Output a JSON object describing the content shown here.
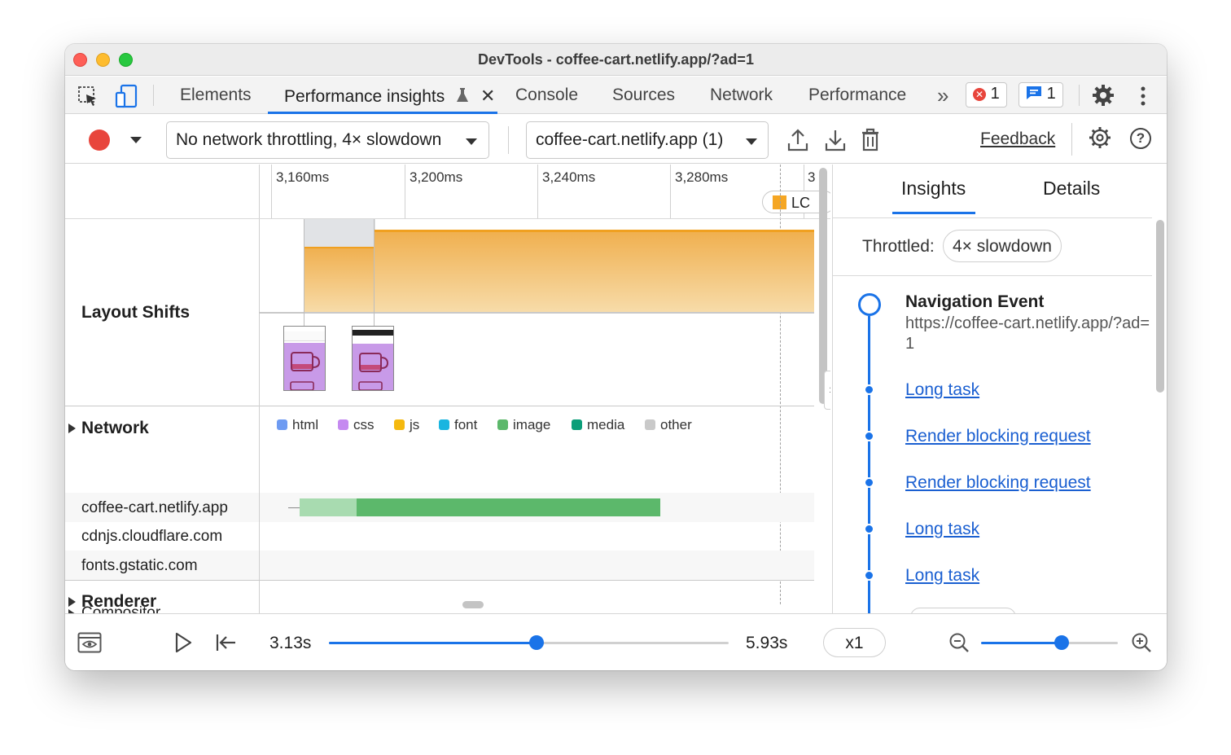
{
  "window": {
    "title": "DevTools - coffee-cart.netlify.app/?ad=1"
  },
  "tabs": {
    "elements": "Elements",
    "performance_insights": "Performance insights",
    "console": "Console",
    "sources": "Sources",
    "network": "Network",
    "performance": "Performance",
    "more": "»",
    "errors_count": "1",
    "messages_count": "1"
  },
  "toolbar": {
    "throttling_value": "No network throttling, 4× slowdown",
    "recording_value": "coffee-cart.netlify.app (1)",
    "feedback": "Feedback"
  },
  "timeline": {
    "ticks": [
      "3,160ms",
      "3,200ms",
      "3,240ms",
      "3,280ms",
      "3"
    ],
    "lcp_marker": "LC",
    "tracks": {
      "layout_shifts": "Layout Shifts",
      "network": "Network",
      "renderer": "Renderer",
      "compositor": "Compositor"
    },
    "legend": [
      {
        "label": "html",
        "color": "#6e9bf2"
      },
      {
        "label": "css",
        "color": "#c58af0"
      },
      {
        "label": "js",
        "color": "#f5b90f"
      },
      {
        "label": "font",
        "color": "#1ab5e0"
      },
      {
        "label": "image",
        "color": "#5cb86b"
      },
      {
        "label": "media",
        "color": "#0b9e79"
      },
      {
        "label": "other",
        "color": "#c9c9c9"
      }
    ],
    "hosts": [
      "coffee-cart.netlify.app",
      "cdnjs.cloudflare.com",
      "fonts.gstatic.com"
    ]
  },
  "insights_panel": {
    "tab_insights": "Insights",
    "tab_details": "Details",
    "throttled_label": "Throttled:",
    "throttled_value": "4× slowdown",
    "nav_title": "Navigation Event",
    "nav_url": "https://coffee-cart.netlify.app/?ad=1",
    "items": [
      "Long task",
      "Render blocking request",
      "Render blocking request",
      "Long task",
      "Long task"
    ]
  },
  "playback": {
    "start_time": "3.13s",
    "end_time": "5.93s",
    "speed": "x1",
    "time_slider_fraction": 0.52,
    "zoom_slider_fraction": 0.59
  },
  "colors": {
    "accent": "#1a73e8",
    "record": "#e8453c",
    "layout_shift_fill": "#f1c27a",
    "layout_shift_line": "#f0a020",
    "network_bar": "#5cb86b",
    "network_bar_wait": "#a8dbb0"
  }
}
